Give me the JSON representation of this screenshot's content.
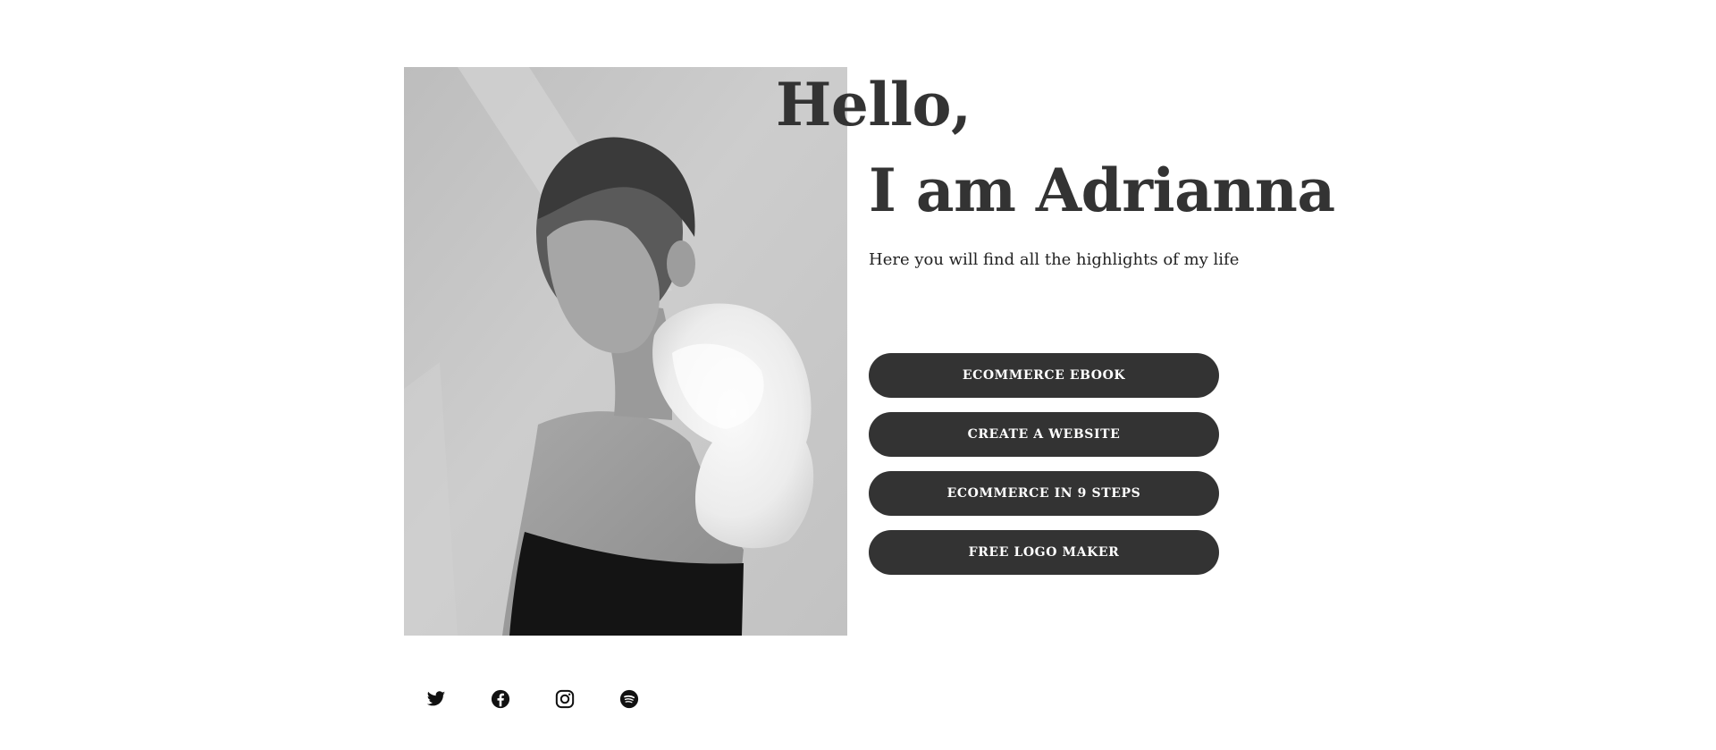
{
  "hero": {
    "greeting": "Hello,",
    "name": "I am Adrianna",
    "subtitle": "Here you will find all the highlights of my life",
    "photo_icon": "portrait-photo"
  },
  "links": [
    {
      "label": "ECOMMERCE EBOOK"
    },
    {
      "label": "CREATE A WEBSITE"
    },
    {
      "label": "ECOMMERCE IN 9 STEPS"
    },
    {
      "label": "FREE LOGO MAKER"
    }
  ],
  "socials": [
    {
      "icon": "twitter-icon"
    },
    {
      "icon": "facebook-icon"
    },
    {
      "icon": "instagram-icon"
    },
    {
      "icon": "spotify-icon"
    }
  ],
  "colors": {
    "button_bg": "#333333",
    "button_text": "#ffffff",
    "heading": "#333333",
    "icon": "#111111"
  }
}
